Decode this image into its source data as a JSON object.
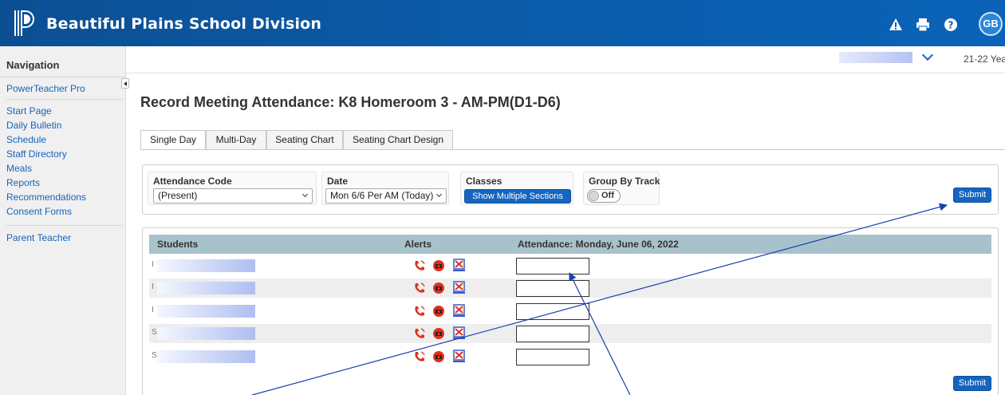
{
  "header": {
    "brand": "Beautiful Plains School Division",
    "user_initials": "GB",
    "icons": [
      "alert-icon",
      "print-icon",
      "help-icon"
    ]
  },
  "sidebar": {
    "title": "Navigation",
    "links_group1": [
      "PowerTeacher Pro"
    ],
    "links_group2": [
      "Start Page",
      "Daily Bulletin",
      "Schedule",
      "Staff Directory",
      "Meals",
      "Reports",
      "Recommendations",
      "Consent Forms"
    ],
    "links_group3": [
      "Parent Teacher"
    ]
  },
  "topbar": {
    "term": "21-22 Yea"
  },
  "page": {
    "title": "Record Meeting Attendance: K8 Homeroom 3 - AM-PM(D1-D6)"
  },
  "tabs": [
    "Single Day",
    "Multi-Day",
    "Seating Chart",
    "Seating Chart Design"
  ],
  "filters": {
    "attendance_code_label": "Attendance Code",
    "attendance_code_value": "(Present)",
    "date_label": "Date",
    "date_value": "Mon 6/6 Per AM (Today)",
    "classes_label": "Classes",
    "classes_button": "Show Multiple Sections",
    "group_by_track_label": "Group By Track",
    "group_by_track_value": "Off",
    "submit": "Submit"
  },
  "attendance": {
    "col_students": "Students",
    "col_alerts": "Alerts",
    "col_attendance": "Attendance: Monday, June 06, 2022",
    "rows": [
      {
        "mark": "I"
      },
      {
        "mark": "I"
      },
      {
        "mark": "I"
      },
      {
        "mark": "S"
      },
      {
        "mark": "S"
      }
    ],
    "submit": "Submit"
  },
  "colors": {
    "header_blue": "#0b5cab",
    "link_blue": "#1763b8",
    "button_blue": "#1565c0",
    "table_header": "#a8c2cc"
  }
}
